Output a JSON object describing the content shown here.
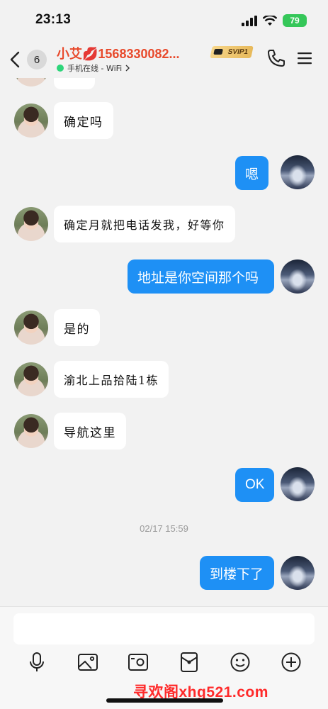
{
  "status_bar": {
    "time": "23:13",
    "battery": "79"
  },
  "header": {
    "unread_count": "6",
    "contact_name": "小艾💋1568330082...",
    "vip_label": "SVIP1",
    "online_status": "手机在线 - WiFi"
  },
  "messages": [
    {
      "side": "in",
      "text": "确定吗"
    },
    {
      "side": "out",
      "text": "嗯"
    },
    {
      "side": "in",
      "text": "确定月就把电话发我，好等你"
    },
    {
      "side": "out",
      "text": "地址是你空间那个吗"
    },
    {
      "side": "in",
      "text": "是的"
    },
    {
      "side": "in",
      "text": "渝北上品拾陆1栋"
    },
    {
      "side": "in",
      "text": "导航这里"
    },
    {
      "side": "out",
      "text": "OK"
    },
    {
      "side": "out",
      "text": "到楼下了"
    }
  ],
  "timestamp": "02/17 15:59",
  "input": {
    "value": "",
    "placeholder": ""
  },
  "toolbar": [
    "microphone-icon",
    "image-icon",
    "camera-icon",
    "red-packet-icon",
    "emoji-icon",
    "plus-icon"
  ],
  "watermark": "寻欢阁xhg521.com",
  "colors": {
    "outgoing_bubble": "#1e90f5",
    "incoming_bubble": "#ffffff",
    "name": "#e84a2c",
    "online_dot": "#2dd57a",
    "watermark": "#ff2a2a"
  }
}
